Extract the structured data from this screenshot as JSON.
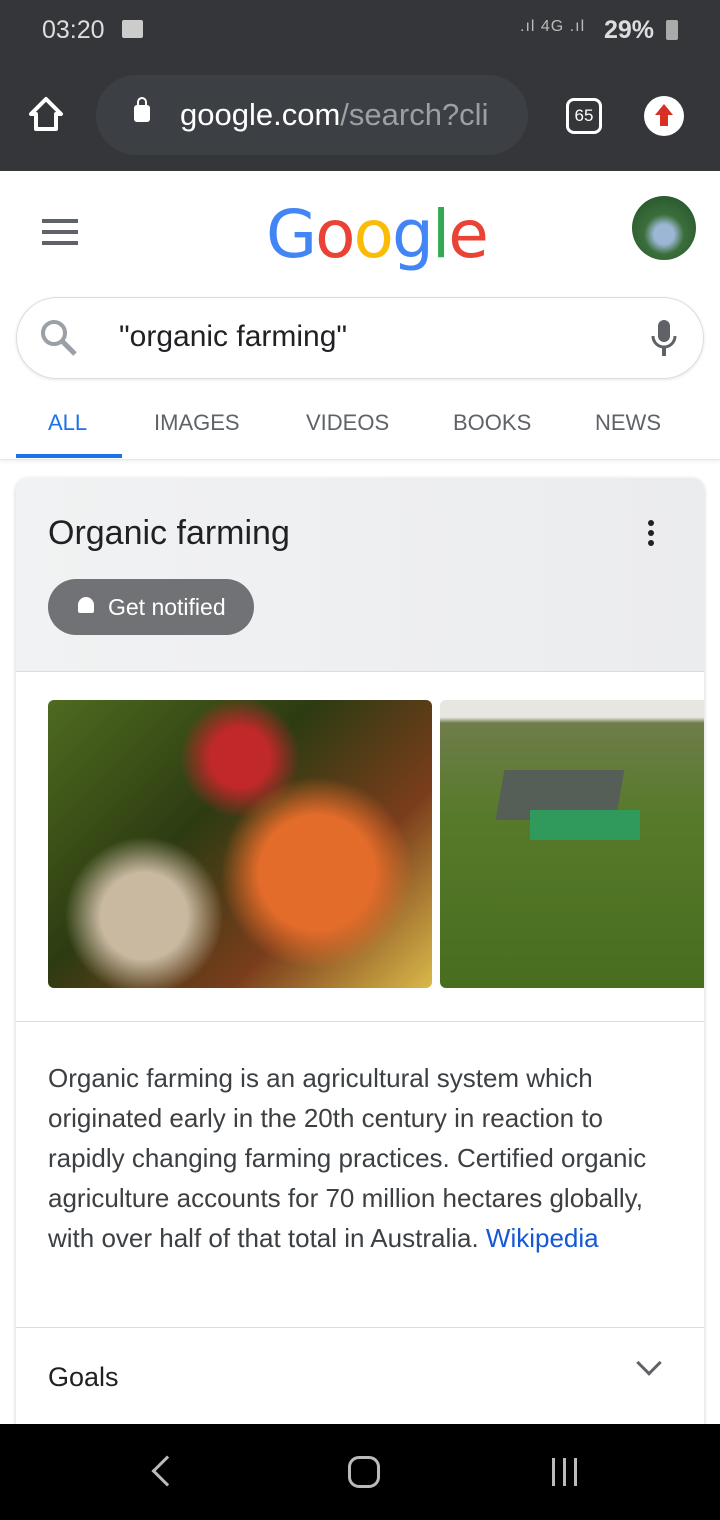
{
  "status_bar": {
    "time": "03:20",
    "network": "4G",
    "battery": "29%"
  },
  "browser": {
    "url_host": "google.com",
    "url_path": "/search?cli",
    "tab_count": "65"
  },
  "google": {
    "logo": [
      "G",
      "o",
      "o",
      "g",
      "l",
      "e"
    ],
    "logo_colors": [
      "#4285f4",
      "#ea4335",
      "#fbbc05",
      "#4285f4",
      "#34a853",
      "#ea4335"
    ]
  },
  "search": {
    "query": "\"organic farming\""
  },
  "tabs": [
    {
      "label": "ALL",
      "active": true
    },
    {
      "label": "IMAGES"
    },
    {
      "label": "VIDEOS"
    },
    {
      "label": "BOOKS"
    },
    {
      "label": "NEWS"
    }
  ],
  "knowledge_panel": {
    "title": "Organic farming",
    "notify_label": "Get notified",
    "description": "Organic farming is an agricultural system which originated early in the 20th century in reaction to rapidly changing farming practices. Certified organic agriculture accounts for 70 million hectares globally, with over half of that total in Australia. ",
    "source_link": "Wikipedia",
    "section": "Goals"
  },
  "colors": {
    "accent": "#1a73e8",
    "toolbar": "#35363a"
  }
}
